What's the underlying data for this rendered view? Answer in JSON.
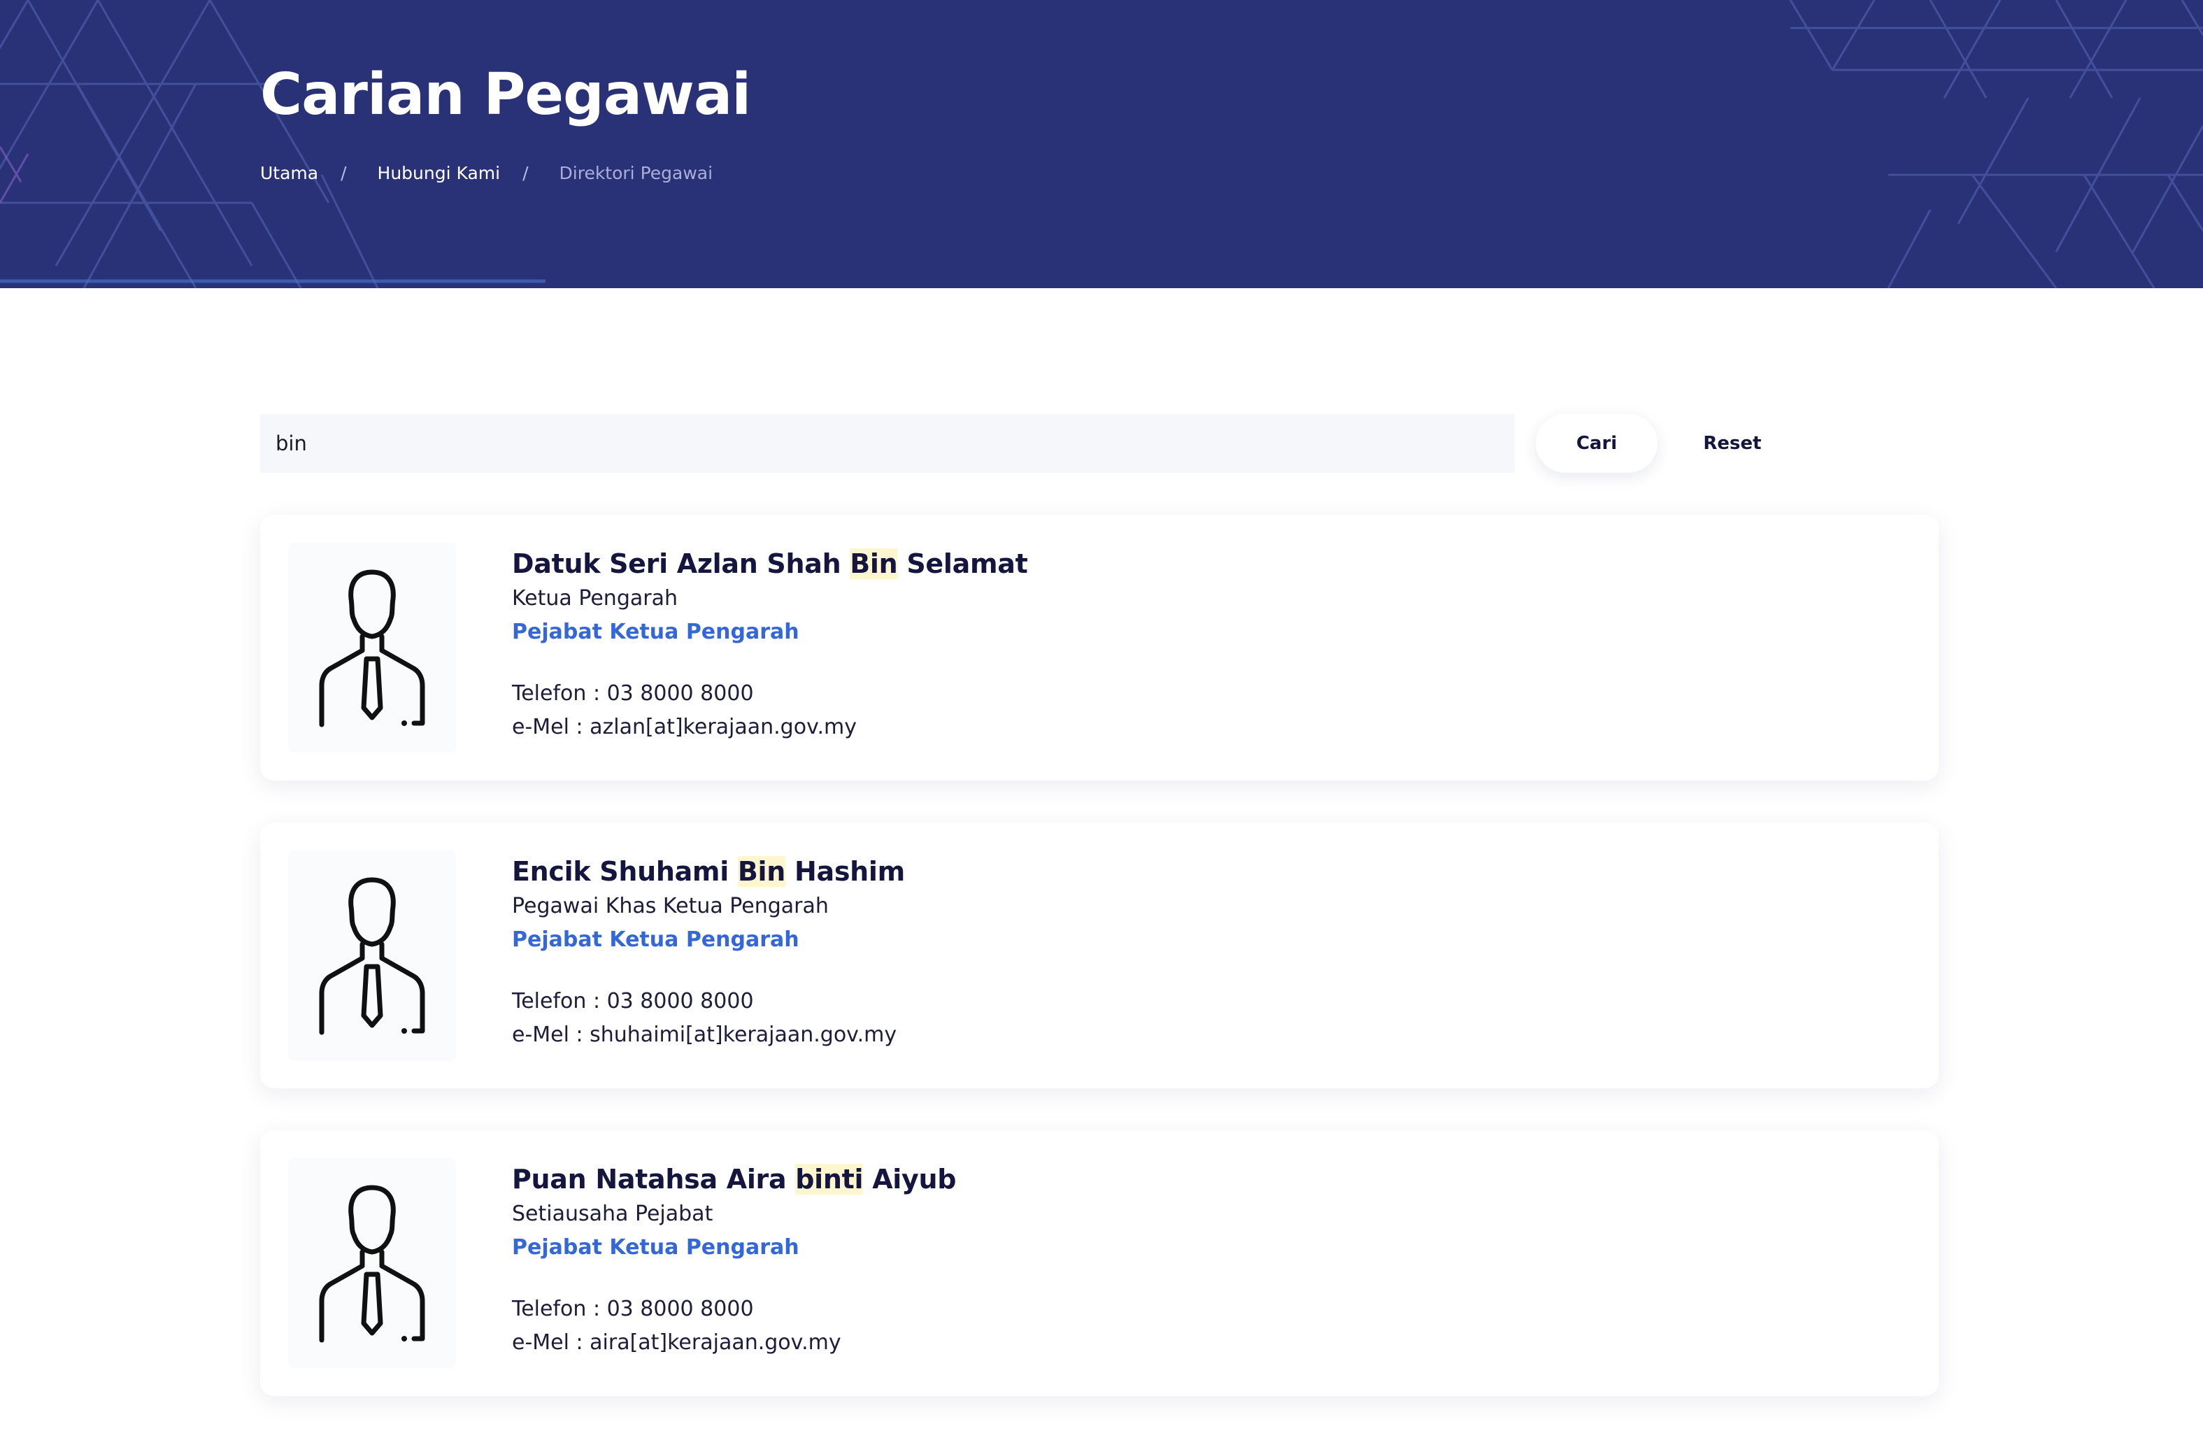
{
  "header": {
    "title": "Carian Pegawai",
    "breadcrumb": [
      {
        "label": "Utama"
      },
      {
        "label": "Hubungi Kami"
      },
      {
        "label": "Direktori Pegawai"
      }
    ],
    "separator": "/",
    "background_color": "#2a3277"
  },
  "search": {
    "value": "bin",
    "search_label": "Cari",
    "reset_label": "Reset"
  },
  "results": [
    {
      "name_before": "Datuk Seri Azlan Shah ",
      "name_highlight": "Bin",
      "name_after": " Selamat",
      "position": "Ketua Pengarah",
      "department": "Pejabat Ketua Pengarah",
      "phone": "Telefon : 03 8000 8000",
      "email": "e-Mel : azlan[at]kerajaan.gov.my",
      "avatar_icon": "person-with-tie-icon"
    },
    {
      "name_before": "Encik Shuhami ",
      "name_highlight": "Bin",
      "name_after": " Hashim",
      "position": "Pegawai Khas Ketua Pengarah",
      "department": "Pejabat Ketua Pengarah",
      "phone": "Telefon : 03 8000 8000",
      "email": "e-Mel : shuhaimi[at]kerajaan.gov.my",
      "avatar_icon": "person-with-tie-icon"
    },
    {
      "name_before": "Puan Natahsa Aira ",
      "name_highlight": "binti",
      "name_after": " Aiyub",
      "position": "Setiausaha Pejabat",
      "department": "Pejabat Ketua Pengarah",
      "phone": "Telefon : 03 8000 8000",
      "email": "e-Mel : aira[at]kerajaan.gov.my",
      "avatar_icon": "person-with-tie-icon"
    }
  ],
  "colors": {
    "link": "#3468d8",
    "highlight": "#fdf6cf",
    "text": "#14163f"
  }
}
